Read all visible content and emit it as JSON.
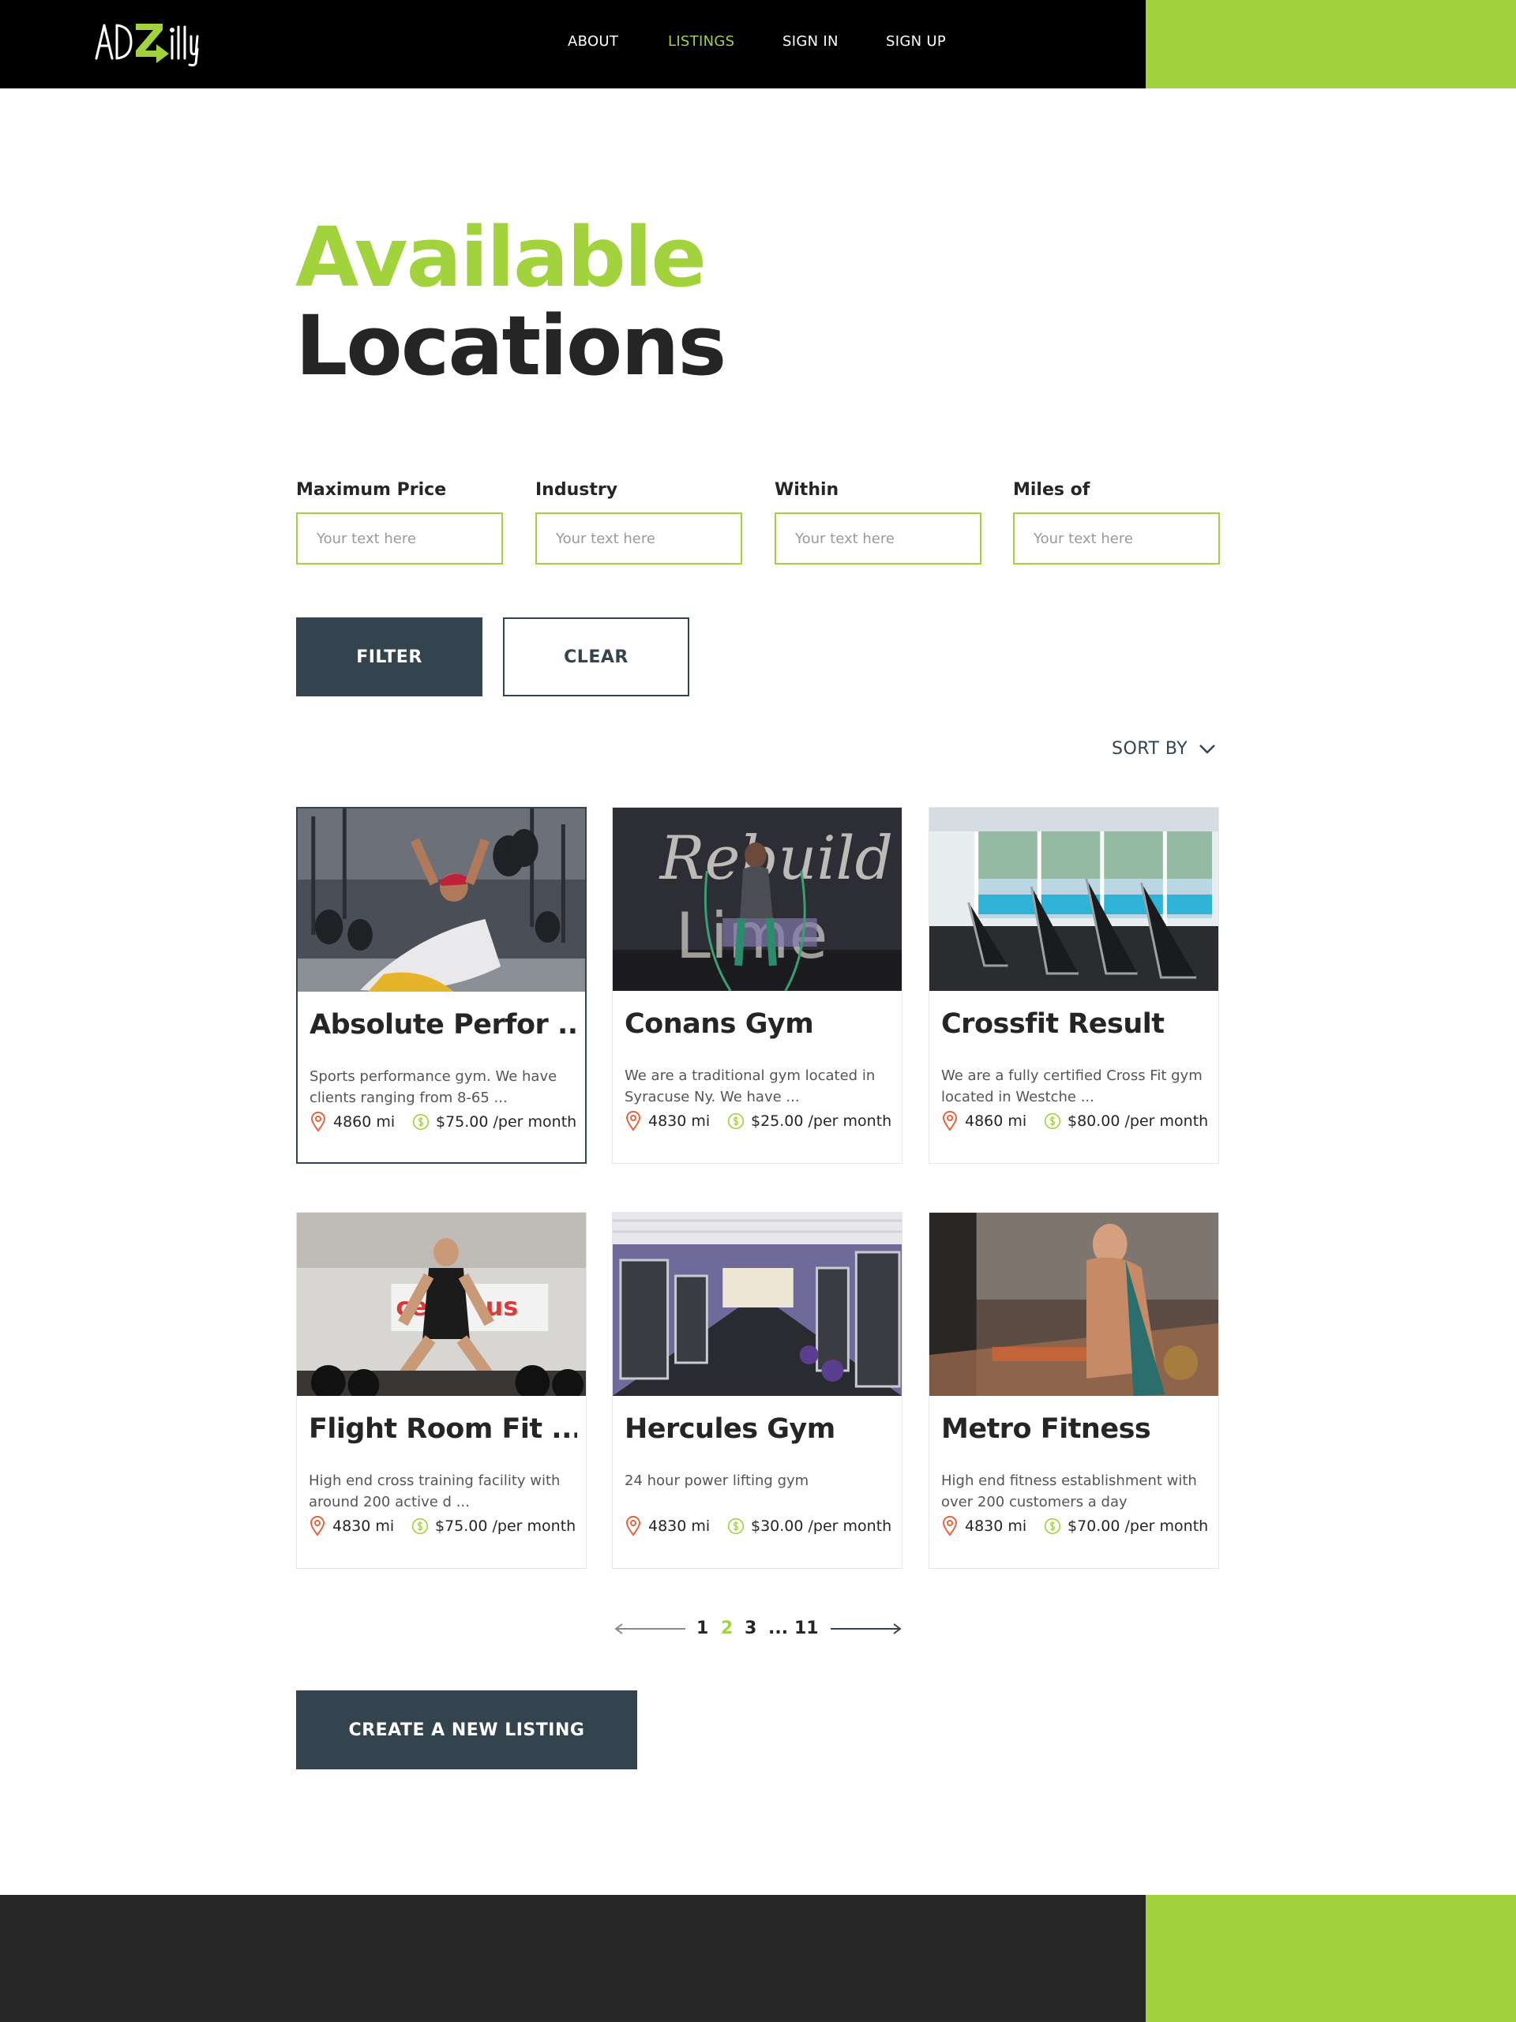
{
  "header": {
    "logo_text": "ADZilly",
    "nav": [
      {
        "label": "ABOUT",
        "active": false
      },
      {
        "label": "LISTINGS",
        "active": true
      },
      {
        "label": "SIGN IN",
        "active": false
      },
      {
        "label": "SIGN UP",
        "active": false
      }
    ]
  },
  "hero": {
    "title_line1": "Available",
    "title_line2": "Locations"
  },
  "filters": {
    "fields": [
      {
        "label": "Maximum Price",
        "placeholder": "Your text here",
        "value": ""
      },
      {
        "label": "Industry",
        "placeholder": "Your text here",
        "value": ""
      },
      {
        "label": "Within",
        "placeholder": "Your text here",
        "value": ""
      },
      {
        "label": "Miles of",
        "placeholder": "Your text here",
        "value": ""
      }
    ],
    "filter_label": "FILTER",
    "clear_label": "CLEAR",
    "sort_label": "SORT BY"
  },
  "listings": [
    {
      "title": "Absolute Perfor ...",
      "description": "Sports performance gym. We have clients ranging from 8-65 ...",
      "distance": "4860 mi",
      "price": "$75.00 /per month",
      "image": "man-bench-press-dumbbells",
      "selected": true
    },
    {
      "title": "Conans Gym",
      "description": "We are a traditional gym located in Syracuse Ny. We have ...",
      "distance": "4830 mi",
      "price": "$25.00 /per month",
      "image": "woman-jump-rope-rebuild-wall",
      "selected": false
    },
    {
      "title": "Crossfit Result",
      "description": "We are a fully certified Cross Fit gym located in Westche ...",
      "distance": "4860 mi",
      "price": "$80.00 /per month",
      "image": "treadmills-pool-view",
      "selected": false
    },
    {
      "title": "Flight Room Fit ...",
      "description": "High end cross training facility with around 200 active d ...",
      "distance": "4830 mi",
      "price": "$75.00 /per month",
      "image": "woman-lifting-cerberus",
      "selected": false
    },
    {
      "title": "Hercules Gym",
      "description": "24 hour power lifting gym",
      "distance": "4830 mi",
      "price": "$30.00 /per month",
      "image": "gym-machines-purple",
      "selected": false
    },
    {
      "title": "Metro Fitness",
      "description": "High end fitness establishment with over 200 customers a day",
      "distance": "4830 mi",
      "price": "$70.00 /per month",
      "image": "man-tank-top-gym",
      "selected": false
    }
  ],
  "pagination": {
    "pages": [
      "1",
      "2",
      "3",
      "...",
      "11"
    ],
    "current": "2"
  },
  "create_label": "CREATE A NEW LISTING",
  "colors": {
    "accent": "#a2d33c",
    "dark": "#34444f",
    "text": "#252525",
    "pin": "#e8633a"
  }
}
